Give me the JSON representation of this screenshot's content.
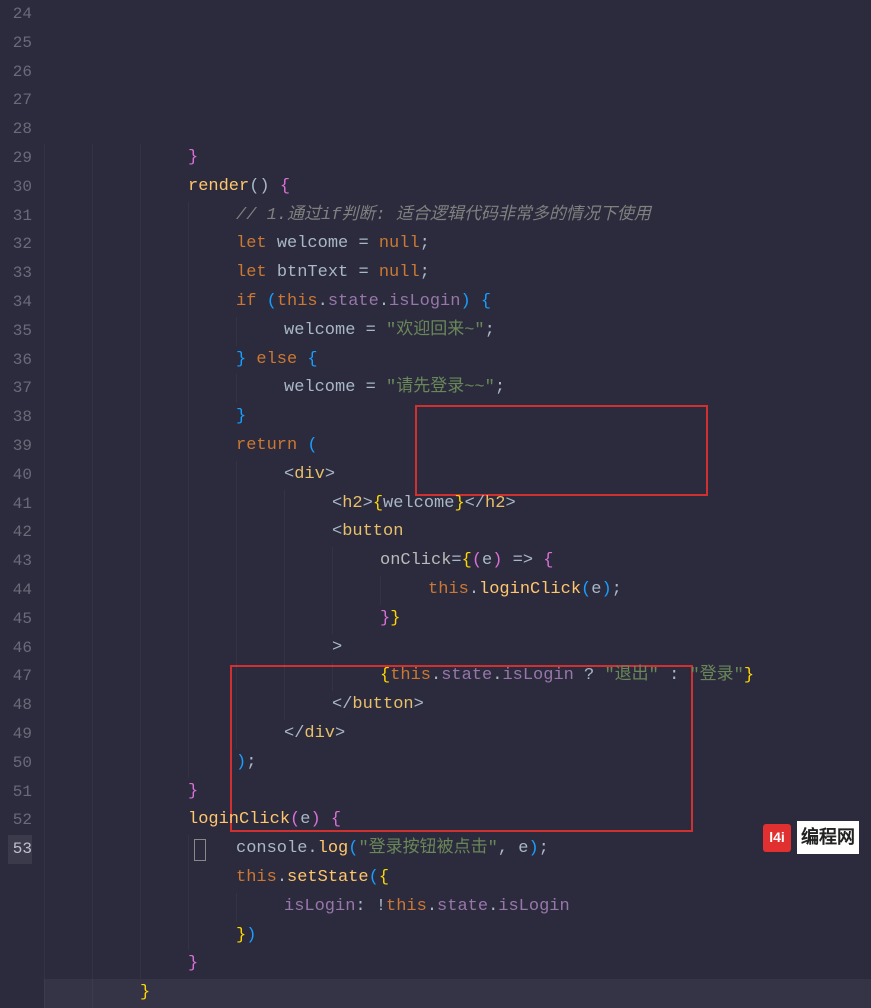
{
  "line_start": 24,
  "line_end": 53,
  "current_line": 53,
  "code_lines": [
    {
      "n": 24,
      "indent": 3,
      "tokens": [
        {
          "t": "}",
          "c": "paren-p"
        }
      ]
    },
    {
      "n": 25,
      "indent": 3,
      "tokens": [
        {
          "t": "render",
          "c": "fn"
        },
        {
          "t": "() ",
          "c": "punct"
        },
        {
          "t": "{",
          "c": "paren-p"
        }
      ]
    },
    {
      "n": 26,
      "indent": 4,
      "tokens": [
        {
          "t": "// 1.通过if判断: 适合逻辑代码非常多的情况下使用",
          "c": "cmt"
        }
      ]
    },
    {
      "n": 27,
      "indent": 4,
      "tokens": [
        {
          "t": "let ",
          "c": "kw"
        },
        {
          "t": "welcome ",
          "c": "var"
        },
        {
          "t": "= ",
          "c": "punct"
        },
        {
          "t": "null",
          "c": "kw"
        },
        {
          "t": ";",
          "c": "punct"
        }
      ]
    },
    {
      "n": 28,
      "indent": 4,
      "tokens": [
        {
          "t": "let ",
          "c": "kw"
        },
        {
          "t": "btnText ",
          "c": "var"
        },
        {
          "t": "= ",
          "c": "punct"
        },
        {
          "t": "null",
          "c": "kw"
        },
        {
          "t": ";",
          "c": "punct"
        }
      ]
    },
    {
      "n": 29,
      "indent": 4,
      "tokens": [
        {
          "t": "if ",
          "c": "kw"
        },
        {
          "t": "(",
          "c": "paren-b"
        },
        {
          "t": "this",
          "c": "this"
        },
        {
          "t": ".",
          "c": "punct"
        },
        {
          "t": "state",
          "c": "prop"
        },
        {
          "t": ".",
          "c": "punct"
        },
        {
          "t": "isLogin",
          "c": "prop"
        },
        {
          "t": ")",
          "c": "paren-b"
        },
        {
          "t": " ",
          "c": "punct"
        },
        {
          "t": "{",
          "c": "paren-b"
        }
      ]
    },
    {
      "n": 30,
      "indent": 5,
      "tokens": [
        {
          "t": "welcome ",
          "c": "var"
        },
        {
          "t": "= ",
          "c": "punct"
        },
        {
          "t": "\"欢迎回来~\"",
          "c": "str"
        },
        {
          "t": ";",
          "c": "punct"
        }
      ]
    },
    {
      "n": 31,
      "indent": 4,
      "tokens": [
        {
          "t": "}",
          "c": "paren-b"
        },
        {
          "t": " ",
          "c": "punct"
        },
        {
          "t": "else ",
          "c": "kw"
        },
        {
          "t": "{",
          "c": "paren-b"
        }
      ]
    },
    {
      "n": 32,
      "indent": 5,
      "tokens": [
        {
          "t": "welcome ",
          "c": "var"
        },
        {
          "t": "= ",
          "c": "punct"
        },
        {
          "t": "\"请先登录~~\"",
          "c": "str"
        },
        {
          "t": ";",
          "c": "punct"
        }
      ]
    },
    {
      "n": 33,
      "indent": 4,
      "tokens": [
        {
          "t": "}",
          "c": "paren-b"
        }
      ]
    },
    {
      "n": 34,
      "indent": 4,
      "tokens": [
        {
          "t": "return ",
          "c": "kw"
        },
        {
          "t": "(",
          "c": "paren-b"
        }
      ]
    },
    {
      "n": 35,
      "indent": 5,
      "tokens": [
        {
          "t": "<",
          "c": "punct"
        },
        {
          "t": "div",
          "c": "tag"
        },
        {
          "t": ">",
          "c": "punct"
        }
      ]
    },
    {
      "n": 36,
      "indent": 6,
      "tokens": [
        {
          "t": "<",
          "c": "punct"
        },
        {
          "t": "h2",
          "c": "tag"
        },
        {
          "t": ">",
          "c": "punct"
        },
        {
          "t": "{",
          "c": "paren-y"
        },
        {
          "t": "welcome",
          "c": "var"
        },
        {
          "t": "}",
          "c": "paren-y"
        },
        {
          "t": "</",
          "c": "punct"
        },
        {
          "t": "h2",
          "c": "tag"
        },
        {
          "t": ">",
          "c": "punct"
        }
      ]
    },
    {
      "n": 37,
      "indent": 6,
      "tokens": [
        {
          "t": "<",
          "c": "punct"
        },
        {
          "t": "button",
          "c": "tag"
        }
      ]
    },
    {
      "n": 38,
      "indent": 7,
      "tokens": [
        {
          "t": "onClick",
          "c": "attr"
        },
        {
          "t": "=",
          "c": "punct"
        },
        {
          "t": "{",
          "c": "paren-y"
        },
        {
          "t": "(",
          "c": "paren-p"
        },
        {
          "t": "e",
          "c": "var"
        },
        {
          "t": ")",
          "c": "paren-p"
        },
        {
          "t": " => ",
          "c": "punct"
        },
        {
          "t": "{",
          "c": "paren-p"
        }
      ]
    },
    {
      "n": 39,
      "indent": 8,
      "tokens": [
        {
          "t": "this",
          "c": "this"
        },
        {
          "t": ".",
          "c": "punct"
        },
        {
          "t": "loginClick",
          "c": "fn"
        },
        {
          "t": "(",
          "c": "paren-b"
        },
        {
          "t": "e",
          "c": "var"
        },
        {
          "t": ")",
          "c": "paren-b"
        },
        {
          "t": ";",
          "c": "punct"
        }
      ]
    },
    {
      "n": 40,
      "indent": 7,
      "tokens": [
        {
          "t": "}",
          "c": "paren-p"
        },
        {
          "t": "}",
          "c": "paren-y"
        }
      ]
    },
    {
      "n": 41,
      "indent": 6,
      "tokens": [
        {
          "t": ">",
          "c": "punct"
        }
      ]
    },
    {
      "n": 42,
      "indent": 7,
      "tokens": [
        {
          "t": "{",
          "c": "paren-y"
        },
        {
          "t": "this",
          "c": "this"
        },
        {
          "t": ".",
          "c": "punct"
        },
        {
          "t": "state",
          "c": "prop"
        },
        {
          "t": ".",
          "c": "punct"
        },
        {
          "t": "isLogin",
          "c": "prop"
        },
        {
          "t": " ? ",
          "c": "punct"
        },
        {
          "t": "\"退出\"",
          "c": "str"
        },
        {
          "t": " : ",
          "c": "punct"
        },
        {
          "t": "\"登录\"",
          "c": "str"
        },
        {
          "t": "}",
          "c": "paren-y"
        }
      ]
    },
    {
      "n": 43,
      "indent": 6,
      "tokens": [
        {
          "t": "</",
          "c": "punct"
        },
        {
          "t": "button",
          "c": "tag"
        },
        {
          "t": ">",
          "c": "punct"
        }
      ]
    },
    {
      "n": 44,
      "indent": 5,
      "tokens": [
        {
          "t": "</",
          "c": "punct"
        },
        {
          "t": "div",
          "c": "tag"
        },
        {
          "t": ">",
          "c": "punct"
        }
      ]
    },
    {
      "n": 45,
      "indent": 4,
      "tokens": [
        {
          "t": ")",
          "c": "paren-b"
        },
        {
          "t": ";",
          "c": "punct"
        }
      ]
    },
    {
      "n": 46,
      "indent": 3,
      "tokens": [
        {
          "t": "}",
          "c": "paren-p"
        }
      ]
    },
    {
      "n": 47,
      "indent": 3,
      "tokens": [
        {
          "t": "loginClick",
          "c": "fn"
        },
        {
          "t": "(",
          "c": "paren-p"
        },
        {
          "t": "e",
          "c": "var"
        },
        {
          "t": ")",
          "c": "paren-p"
        },
        {
          "t": " ",
          "c": "punct"
        },
        {
          "t": "{",
          "c": "paren-p"
        }
      ]
    },
    {
      "n": 48,
      "indent": 4,
      "tokens": [
        {
          "t": "console",
          "c": "var"
        },
        {
          "t": ".",
          "c": "punct"
        },
        {
          "t": "log",
          "c": "fn"
        },
        {
          "t": "(",
          "c": "paren-b"
        },
        {
          "t": "\"登录按钮被点击\"",
          "c": "str"
        },
        {
          "t": ", ",
          "c": "punct"
        },
        {
          "t": "e",
          "c": "var"
        },
        {
          "t": ")",
          "c": "paren-b"
        },
        {
          "t": ";",
          "c": "punct"
        }
      ]
    },
    {
      "n": 49,
      "indent": 4,
      "tokens": [
        {
          "t": "this",
          "c": "this"
        },
        {
          "t": ".",
          "c": "punct"
        },
        {
          "t": "setState",
          "c": "fn"
        },
        {
          "t": "(",
          "c": "paren-b"
        },
        {
          "t": "{",
          "c": "paren-y"
        }
      ]
    },
    {
      "n": 50,
      "indent": 5,
      "tokens": [
        {
          "t": "isLogin",
          "c": "prop"
        },
        {
          "t": ": ",
          "c": "punct"
        },
        {
          "t": "!",
          "c": "punct"
        },
        {
          "t": "this",
          "c": "this"
        },
        {
          "t": ".",
          "c": "punct"
        },
        {
          "t": "state",
          "c": "prop"
        },
        {
          "t": ".",
          "c": "punct"
        },
        {
          "t": "isLogin",
          "c": "prop"
        }
      ]
    },
    {
      "n": 51,
      "indent": 4,
      "tokens": [
        {
          "t": "}",
          "c": "paren-y"
        },
        {
          "t": ")",
          "c": "paren-b"
        }
      ]
    },
    {
      "n": 52,
      "indent": 3,
      "tokens": [
        {
          "t": "}",
          "c": "paren-p"
        }
      ]
    },
    {
      "n": 53,
      "indent": 2,
      "tokens": [
        {
          "t": "}",
          "c": "paren-y"
        }
      ]
    }
  ],
  "logo": {
    "badge": "l4i",
    "text": "编程网"
  }
}
